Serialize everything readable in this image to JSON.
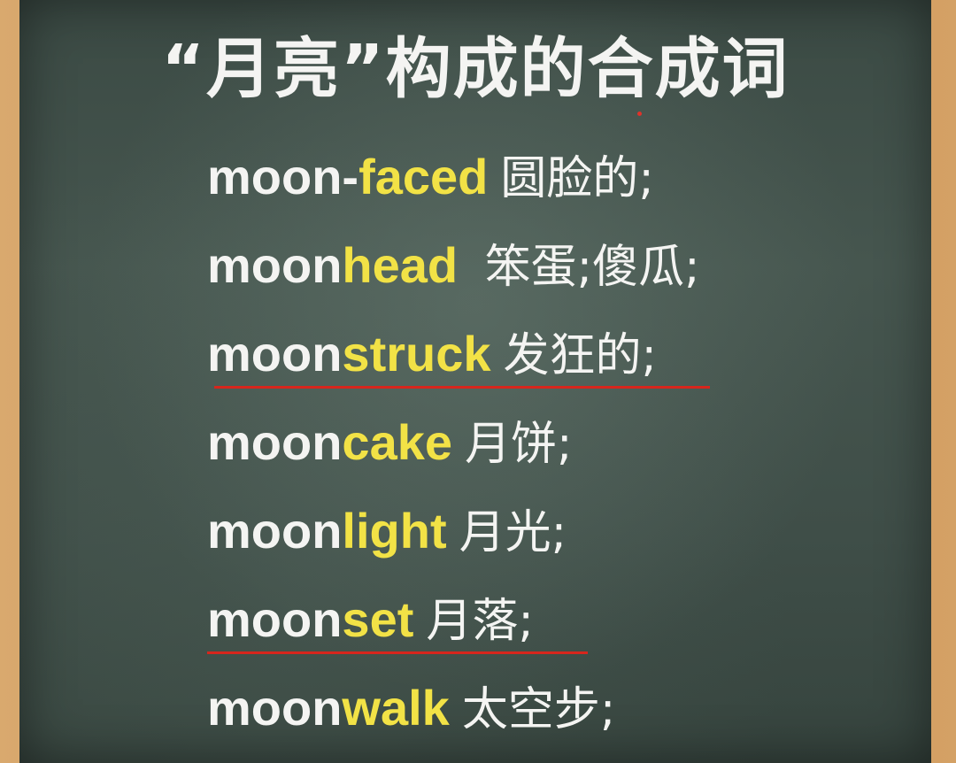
{
  "title": "“月亮”构成的合成词",
  "entries": [
    {
      "prefix": "moon-",
      "suffix": "faced",
      "meaning": "圆脸的;"
    },
    {
      "prefix": "moon",
      "suffix": "head",
      "meaning": " 笨蛋;傻瓜;"
    },
    {
      "prefix": "moon",
      "suffix": "struck",
      "meaning": "发狂的;"
    },
    {
      "prefix": "moon",
      "suffix": "cake",
      "meaning": "月饼;"
    },
    {
      "prefix": "moon",
      "suffix": "light",
      "meaning": "月光;"
    },
    {
      "prefix": "moon",
      "suffix": "set",
      "meaning": "月落;"
    },
    {
      "prefix": "moon",
      "suffix": "walk",
      "meaning": "太空步;"
    }
  ],
  "colors": {
    "board": "#3f4e48",
    "frame": "#c98f55",
    "chalk_white": "#f4f4f2",
    "chalk_yellow": "#f2e246",
    "underline_red": "#d7261d"
  }
}
